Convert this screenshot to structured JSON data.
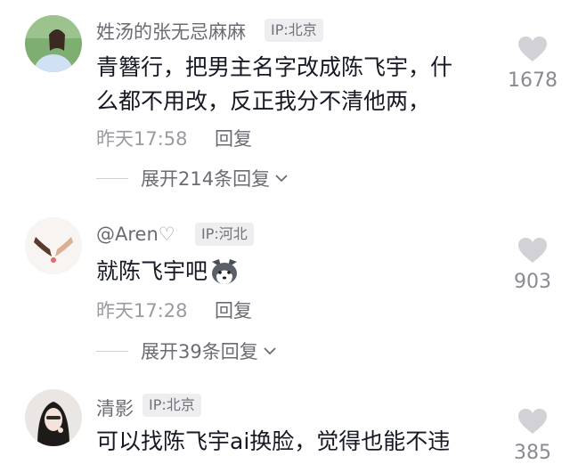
{
  "comments": [
    {
      "username": "姓汤的张无忌麻麻",
      "ip": "IP:北京",
      "text_line1": "青簪行，把男主名字改成陈飞宇，什",
      "text_line2": "么都不用改，反正我分不清他两，",
      "time": "昨天17:58",
      "reply": "回复",
      "expand": "展开214条回复",
      "likes": "1678"
    },
    {
      "username": "@Aren",
      "username_emoji": "🤍",
      "ip": "IP:河北",
      "text_line1": "就陈飞宇吧",
      "emoji_icon": "husky-dog-emoji",
      "time": "昨天17:28",
      "reply": "回复",
      "expand": "展开39条回复",
      "likes": "903"
    },
    {
      "username": "清影",
      "ip": "IP:北京",
      "text_line1": "可以找陈飞宇ai换脸，觉得也能不违",
      "likes": "385"
    }
  ],
  "colors": {
    "username": "#6b6b73",
    "text": "#161823",
    "meta": "#9a9aa1",
    "heart": "#d2d2d6",
    "badge_bg": "#eeeef0"
  }
}
